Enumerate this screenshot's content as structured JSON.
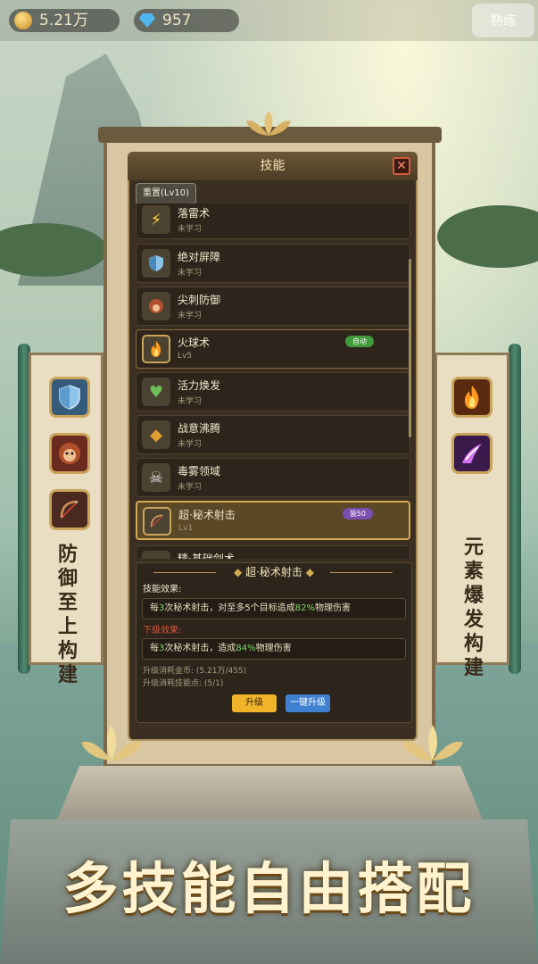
{
  "topbar": {
    "gold": "5.21万",
    "gems": "957",
    "right_button": "熟练"
  },
  "panel": {
    "title": "技能",
    "close": "✕",
    "reset_button": "重置(Lv10)"
  },
  "skills": [
    {
      "name": "落雷术",
      "status": "未学习",
      "icon": "lightning-icon"
    },
    {
      "name": "绝对屏障",
      "status": "未学习",
      "icon": "shield-icon"
    },
    {
      "name": "尖刺防御",
      "status": "未学习",
      "icon": "spike-beast-icon"
    },
    {
      "name": "火球术",
      "status": "Lv5",
      "icon": "fire-icon",
      "tag": "自动",
      "tag_color": "#3f9a3a"
    },
    {
      "name": "活力焕发",
      "status": "未学习",
      "icon": "heart-icon"
    },
    {
      "name": "战意沸腾",
      "status": "未学习",
      "icon": "diamond-icon"
    },
    {
      "name": "毒雾领域",
      "status": "未学习",
      "icon": "skull-icon"
    },
    {
      "name": "超·秘术射击",
      "status": "Lv1",
      "icon": "bow-icon",
      "tag": "装50",
      "tag_color": "#7a4fb0",
      "selected": true
    },
    {
      "name": "精·基础剑术",
      "status": "",
      "icon": "sword-icon"
    }
  ],
  "detail": {
    "title": "超·秘术射击",
    "effect_label": "技能效果:",
    "effect_prefix": "每",
    "effect_num1": "3",
    "effect_mid": "次秘术射击，对至多5个目标造成",
    "effect_pct": "82%",
    "effect_suffix": "物理伤害",
    "next_label": "下级效果:",
    "next_prefix": "每",
    "next_num1": "3",
    "next_mid": "次秘术射击，造成",
    "next_pct": "84%",
    "next_suffix": "物理伤害",
    "cost_gold": "升级消耗金币: (5.21万/455)",
    "cost_points": "升级消耗技能点: (5/1)",
    "upgrade_button": "升级",
    "upgrade_all_button": "一键升级"
  },
  "left_scroll": {
    "text": "防御至上构建",
    "icons": [
      "shield-icon",
      "beast-icon",
      "bow-icon"
    ]
  },
  "right_scroll": {
    "text": "元素爆发构建",
    "icons": [
      "fire-icon",
      "arcane-burst-icon"
    ]
  },
  "slogan": "多技能自由搭配",
  "colors": {
    "accent_gold": "#d2aa52",
    "green_value": "#7bd66b",
    "red_label": "#e0523a",
    "upgrade_btn": "#f0b42a",
    "upgrade_all_btn": "#3f7fd0"
  }
}
